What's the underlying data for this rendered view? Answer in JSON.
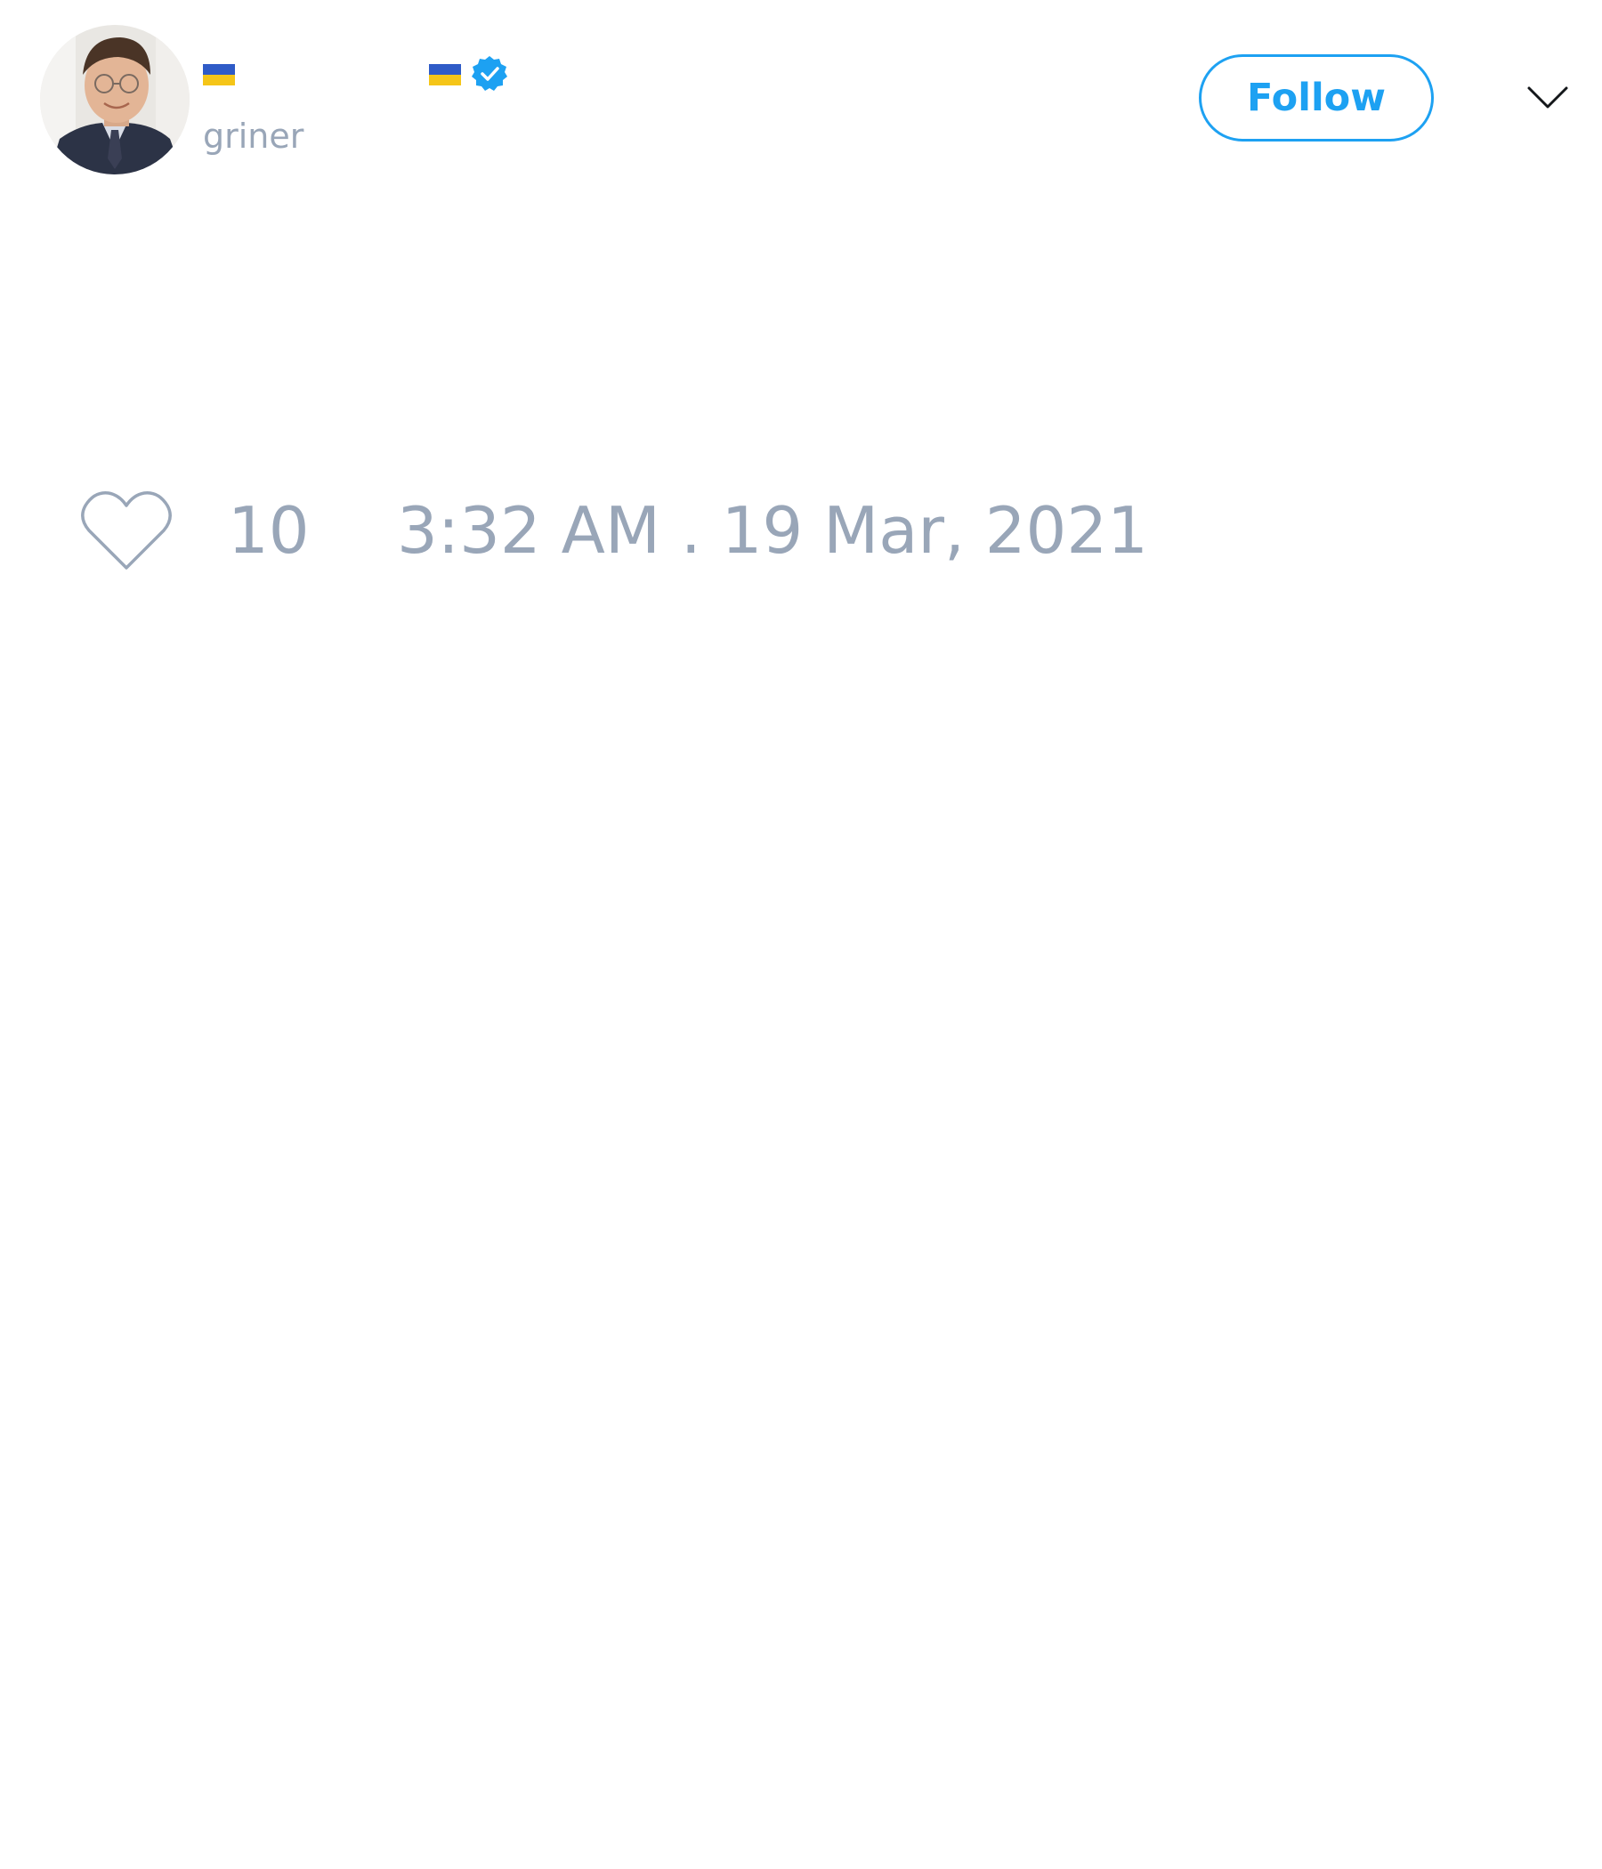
{
  "author": {
    "display_name_flags": [
      "ukraine-flag",
      "ukraine-flag"
    ],
    "verified": true,
    "handle": "griner",
    "avatar": "profile-photo"
  },
  "header": {
    "follow_label": "Follow",
    "menu_icon": "chevron-down-icon"
  },
  "tweet": {
    "like_icon": "heart-outline-icon",
    "like_count": "10",
    "timestamp": "3:32 AM . 19 Mar, 2021"
  },
  "colors": {
    "accent": "#1da1f2",
    "muted_text": "#99a6b8",
    "flag_blue": "#2f5bc7",
    "flag_yellow": "#f5c518"
  }
}
